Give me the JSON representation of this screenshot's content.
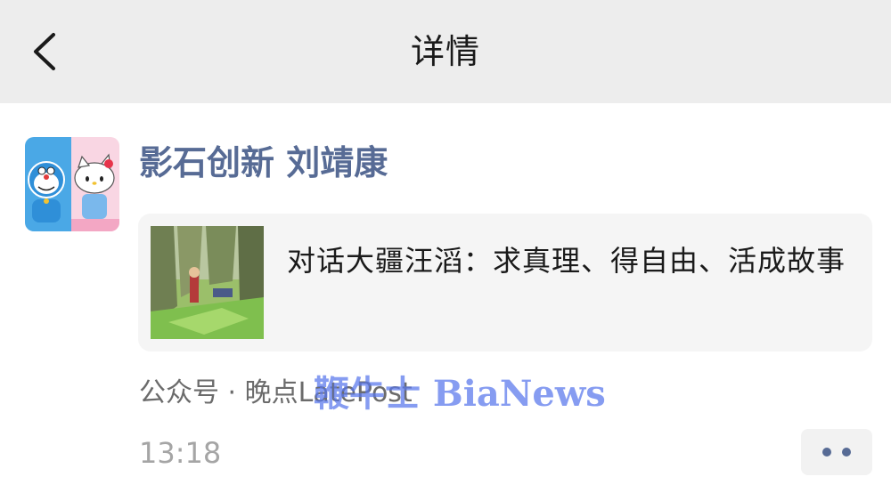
{
  "header": {
    "title": "详情",
    "back_icon": "chevron-left-icon"
  },
  "post": {
    "author": "影石创新 刘靖康",
    "avatar": {
      "left_color": "#4aa8e6",
      "right_color": "#f9d6e3"
    },
    "article": {
      "title": "对话大疆汪滔：求真理、得自由、活成故事"
    },
    "source_label": "公众号 · 晚点",
    "source_account": "LatePost",
    "time": "13:18",
    "more_icon": "more-dots-icon"
  },
  "watermark": "鞭牛士 BiaNews",
  "colors": {
    "link": "#576b95",
    "topbar": "#ededed",
    "card": "#f5f5f5",
    "watermark": "#5876eb"
  }
}
